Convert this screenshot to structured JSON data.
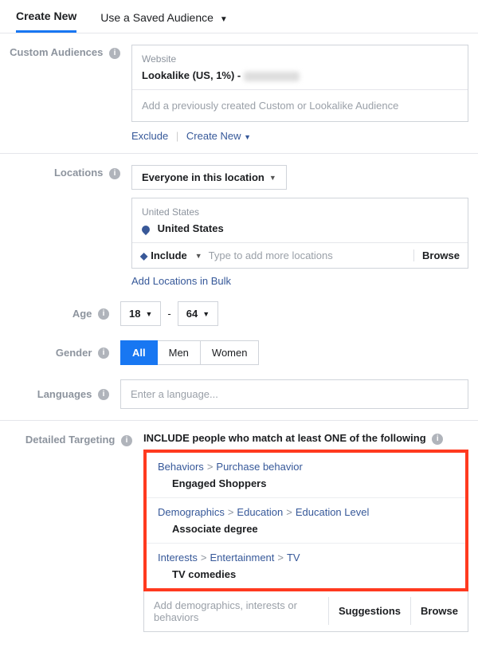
{
  "tabs": {
    "createNew": "Create New",
    "saved": "Use a Saved Audience"
  },
  "customAudiences": {
    "label": "Custom Audiences",
    "categoryLabel": "Website",
    "selectedLabel": "Lookalike (US, 1%) -",
    "inputPlaceholder": "Add a previously created Custom or Lookalike Audience",
    "excludeLabel": "Exclude",
    "createNewLabel": "Create New"
  },
  "locations": {
    "label": "Locations",
    "dropdownLabel": "Everyone in this location",
    "regionLabel": "United States",
    "selectedLabel": "United States",
    "includeLabel": "Include",
    "inputPlaceholder": "Type to add more locations",
    "browseLabel": "Browse",
    "bulkLabel": "Add Locations in Bulk"
  },
  "age": {
    "label": "Age",
    "min": "18",
    "max": "64"
  },
  "gender": {
    "label": "Gender",
    "options": [
      "All",
      "Men",
      "Women"
    ],
    "selected": "All"
  },
  "languages": {
    "label": "Languages",
    "placeholder": "Enter a language..."
  },
  "detailedTargeting": {
    "label": "Detailed Targeting",
    "headline": "INCLUDE people who match at least ONE of the following",
    "items": [
      {
        "path": [
          "Behaviors",
          "Purchase behavior"
        ],
        "value": "Engaged Shoppers"
      },
      {
        "path": [
          "Demographics",
          "Education",
          "Education Level"
        ],
        "value": "Associate degree"
      },
      {
        "path": [
          "Interests",
          "Entertainment",
          "TV"
        ],
        "value": "TV comedies"
      }
    ],
    "inputPlaceholder": "Add demographics, interests or behaviors",
    "suggestionsLabel": "Suggestions",
    "browseLabel": "Browse"
  }
}
